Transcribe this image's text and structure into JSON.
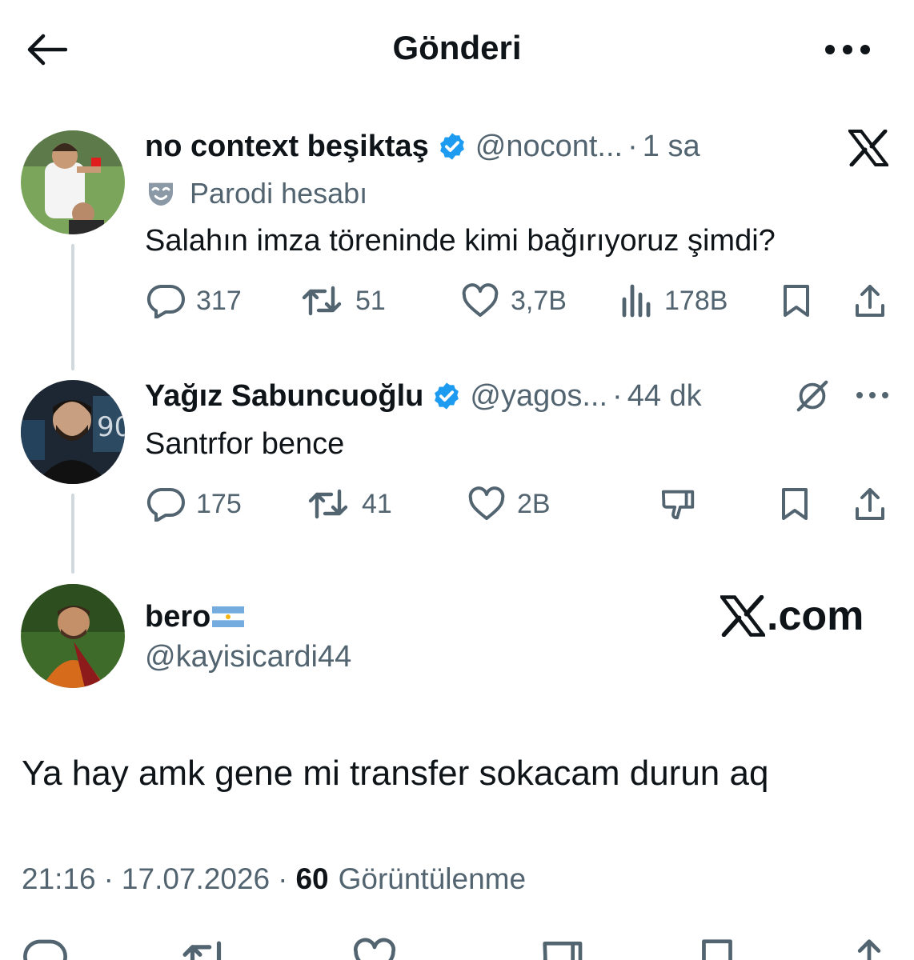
{
  "header": {
    "title": "Gönderi"
  },
  "tweets": [
    {
      "name": "no context beşiktaş",
      "handle": "@nocont...",
      "time": "1 sa",
      "separator": "·",
      "badge": "Parodi hesabı",
      "text": "Salahın imza töreninde kimi bağırıyoruz şimdi?",
      "stats": {
        "replies": "317",
        "reposts": "51",
        "likes": "3,7B",
        "views": "178B"
      }
    },
    {
      "name": "Yağız Sabuncuoğlu",
      "handle": "@yagos...",
      "time": "44 dk",
      "separator": "·",
      "text": "Santrfor bence",
      "stats": {
        "replies": "175",
        "reposts": "41",
        "likes": "2B"
      }
    }
  ],
  "main_tweet": {
    "name": "bero",
    "handle": "@kayisicardi44",
    "watermark": "X.com",
    "text": "Ya hay amk gene mi transfer sokacam durun aq",
    "meta": {
      "time": "21:16",
      "date": "17.07.2026",
      "separator": "·",
      "views_count": "60",
      "views_label": "Görüntülenme"
    }
  },
  "icons": {
    "back": "arrow-left-icon",
    "more": "more-horizontal-icon",
    "x_logo": "x-logo-icon",
    "verified": "verified-badge-icon",
    "parody": "mask-icon",
    "grok": "grok-icon",
    "flag": "argentina-flag-icon"
  },
  "colors": {
    "verified": "#1d9bf0",
    "text": "#0f1419",
    "muted": "#536471",
    "line": "#cfd9de"
  }
}
